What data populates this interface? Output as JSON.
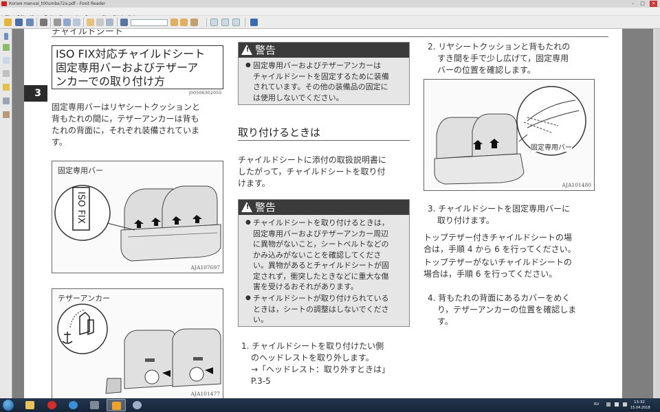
{
  "window": {
    "title": "Копия manual_t00umba72a.pdf - Foxit Reader"
  },
  "menu": [
    "File",
    "Edit",
    "View",
    "Tools",
    "Comments",
    "Forms",
    "SharePoint",
    "Help"
  ],
  "page": {
    "running_head": "チャイルドシート",
    "section_tab": "3",
    "title": [
      "ISO FIX対応チャイルドシート",
      "固定専用バーおよびテザーア",
      "ンカーでの取り付け方"
    ],
    "title_code": "J00506302055",
    "intro": [
      "固定専用バーはリヤシートクッションと",
      "背もたれの間に，テザーアンカーは背も",
      "たれの背面に，それぞれ装備されていま",
      "す。"
    ],
    "fig1": {
      "label": "固定専用バー",
      "code": "AJA107697",
      "isofix": "ISO FIX"
    },
    "fig2": {
      "label": "テザーアンカー",
      "code": "AJA101477"
    },
    "warning_title": "警告",
    "warning1": [
      "固定専用バーおよびテザーアンカーは",
      "チャイルドシートを固定するために装備",
      "されています。その他の装備品の固定に",
      "は使用しないでください。"
    ],
    "heading_install": "取り付けるときは",
    "install_intro": [
      "チャイルドシートに添付の取扱説明書に",
      "したがって，チャイルドシートを取り付",
      "けます。"
    ],
    "warning2a": [
      "チャイルドシートを取り付けるときは，",
      "固定専用バーおよびテザーアンカー周辺",
      "に異物がないこと，シートベルトなどの",
      "かみ込みがないことを確認してくださ",
      "い。異物があるとチャイルドシートが固",
      "定されず，衝突したときなどに重大な傷",
      "害を受けるおそれがあります。"
    ],
    "warning2b": [
      "チャイルドシートが取り付けられている",
      "ときは，シートの調整はしないでくださ",
      "い。"
    ],
    "step1": [
      "1. チャイルドシートを取り付けたい側",
      "のヘッドレストを取り外します。",
      "→「ヘッドレスト：取り外すときは」",
      "P.3-5"
    ],
    "step2": [
      "2. リヤシートクッションと背もたれの",
      "すき間を手で少し広げて，固定専用",
      "バーの位置を確認します。"
    ],
    "fig3": {
      "code": "AJA101480",
      "callout": "固定専用バー"
    },
    "step3": [
      "3. チャイルドシートを固定専用バーに",
      "取り付けます。"
    ],
    "note_top": [
      "トップテザー付きチャイルドシートの場",
      "合は，手順 4 から 6 を行ってください。"
    ],
    "note_no": [
      "トップテザーがないチャイルドシートの",
      "場合は，手順 6 を行ってください。"
    ],
    "step4": [
      "4. 背もたれの背面にあるカバーをめく",
      "り，テザーアンカーの位置を確認しま",
      "す。"
    ]
  },
  "tray": {
    "lang": "RU",
    "time": "13:32",
    "date": "15.04.2018"
  },
  "icons": {
    "app": "foxit-icon",
    "start": "windows-start-icon"
  }
}
